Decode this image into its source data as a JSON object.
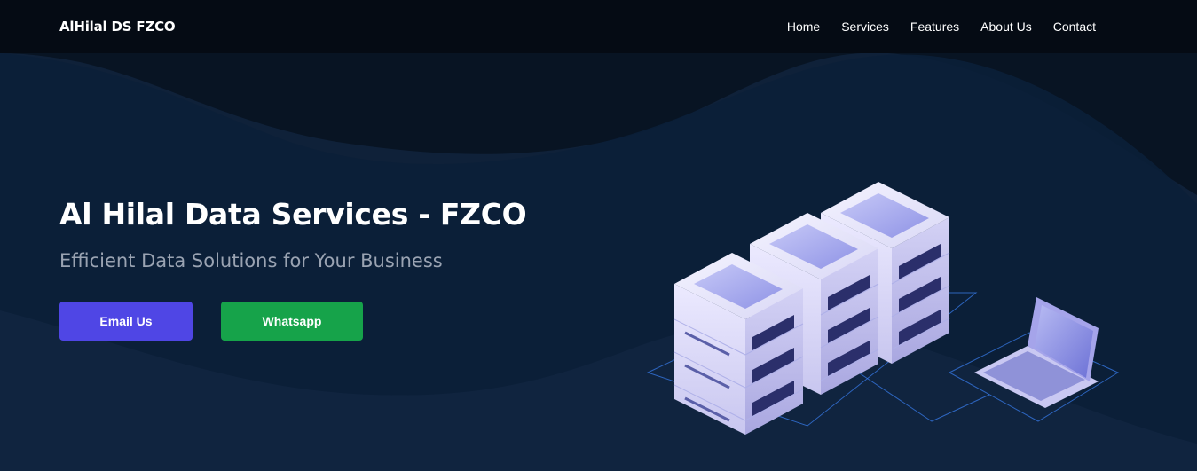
{
  "header": {
    "brand": "AlHilal DS FZCO",
    "nav": [
      {
        "label": "Home"
      },
      {
        "label": "Services"
      },
      {
        "label": "Features"
      },
      {
        "label": "About Us"
      },
      {
        "label": "Contact"
      }
    ]
  },
  "hero": {
    "title": "Al Hilal Data Services - FZCO",
    "subtitle": "Efficient Data Solutions for Your Business",
    "buttons": {
      "email": "Email Us",
      "whatsapp": "Whatsapp"
    }
  },
  "colors": {
    "nav_bg": "#050b14",
    "hero_dark": "#0a1628",
    "hero_mid": "#0e2038",
    "email_button": "#4f46e5",
    "whatsapp_button": "#16a34a"
  },
  "illustration": {
    "icon": "server-rack-laptop-illustration"
  }
}
